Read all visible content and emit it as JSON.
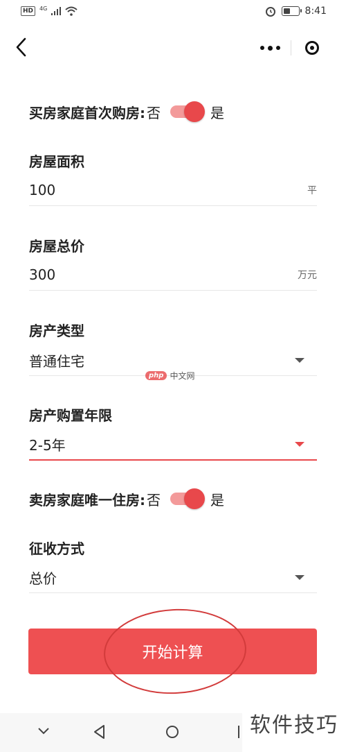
{
  "status_bar": {
    "hd": "HD",
    "network": "4G",
    "time": "8:41",
    "battery_level": 0.45
  },
  "form": {
    "first_home": {
      "label": "买房家庭首次购房:",
      "off": "否",
      "on": "是",
      "value": true
    },
    "area": {
      "label": "房屋面积",
      "value": "100",
      "unit": "平"
    },
    "total_price": {
      "label": "房屋总价",
      "value": "300",
      "unit": "万元"
    },
    "property_type": {
      "label": "房产类型",
      "value": "普通住宅"
    },
    "years_held": {
      "label": "房产购置年限",
      "value": "2-5年"
    },
    "seller_only_home": {
      "label": "卖房家庭唯一住房:",
      "off": "否",
      "on": "是",
      "value": true
    },
    "levy_method": {
      "label": "征收方式",
      "value": "总价"
    },
    "submit_label": "开始计算"
  },
  "watermarks": {
    "mid_logo": "php",
    "mid_text": "中文网",
    "corner_text": "软件技巧"
  },
  "colors": {
    "accent": "#ee5052",
    "switch_track": "#f39a9a",
    "knob": "#e8484b"
  }
}
